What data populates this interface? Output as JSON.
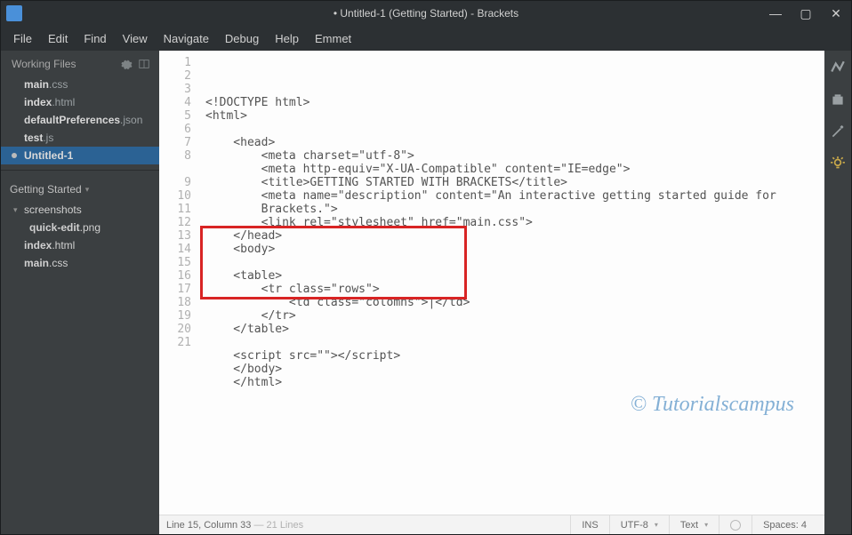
{
  "window": {
    "title": "• Untitled-1 (Getting Started) - Brackets"
  },
  "menu": {
    "file": "File",
    "edit": "Edit",
    "find": "Find",
    "view": "View",
    "navigate": "Navigate",
    "debug": "Debug",
    "help": "Help",
    "emmet": "Emmet"
  },
  "sidebar": {
    "workingFilesLabel": "Working Files",
    "workingFiles": [
      {
        "base": "main",
        "ext": ".css",
        "dirty": false,
        "active": false
      },
      {
        "base": "index",
        "ext": ".html",
        "dirty": false,
        "active": false
      },
      {
        "base": "defaultPreferences",
        "ext": ".json",
        "dirty": false,
        "active": false
      },
      {
        "base": "test",
        "ext": ".js",
        "dirty": false,
        "active": false
      },
      {
        "base": "Untitled-1",
        "ext": "",
        "dirty": true,
        "active": true
      }
    ],
    "projectName": "Getting Started",
    "tree": {
      "folder": "screenshots",
      "folderChild": {
        "base": "quick-edit",
        "ext": ".png"
      },
      "files": [
        {
          "base": "index",
          "ext": ".html"
        },
        {
          "base": "main",
          "ext": ".css"
        }
      ]
    }
  },
  "editor": {
    "lines": [
      "<!DOCTYPE html>",
      "<html>",
      "",
      "    <head>",
      "        <meta charset=\"utf-8\">",
      "        <meta http-equiv=\"X-UA-Compatible\" content=\"IE=edge\">",
      "        <title>GETTING STARTED WITH BRACKETS</title>",
      "        <meta name=\"description\" content=\"An interactive getting started guide for",
      "        Brackets.\">",
      "        <link rel=\"stylesheet\" href=\"main.css\">",
      "    </head>",
      "    <body>",
      "",
      "    <table>",
      "        <tr class=\"rows\">",
      "            <td class=\"colomns\">|</td>",
      "        </tr>",
      "    </table>",
      "",
      "    <script src=\"\"></script>",
      "    </body>",
      "    </html>"
    ],
    "lineNumbers": [
      "1",
      "2",
      "3",
      "4",
      "5",
      "6",
      "7",
      "8",
      "",
      "9",
      "10",
      "11",
      "12",
      "13",
      "14",
      "15",
      "16",
      "17",
      "18",
      "19",
      "20",
      "21"
    ],
    "highlight": {
      "startLine": 13,
      "endLine": 17
    }
  },
  "watermark": "© Tutorialscampus",
  "status": {
    "cursor": "Line 15, Column 33",
    "lineCount": "— 21 Lines",
    "ins": "INS",
    "encoding": "UTF-8",
    "filetype": "Text",
    "spaces": "Spaces: 4"
  }
}
